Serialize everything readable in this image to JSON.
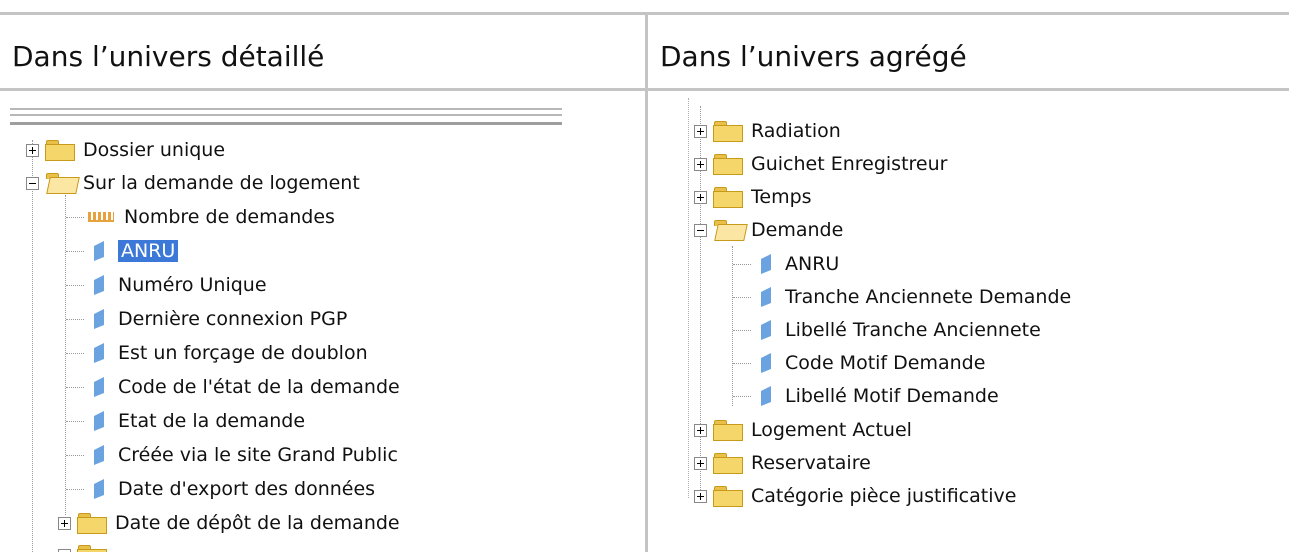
{
  "headers": {
    "left": "Dans l’univers détaillé",
    "right": "Dans l’univers agrégé"
  },
  "left_tree": {
    "folders": [
      {
        "label": "Dossier unique",
        "state": "collapsed"
      },
      {
        "label": "Sur la demande de logement",
        "state": "expanded"
      }
    ],
    "items": [
      {
        "label": "Nombre de demandes",
        "type": "measure"
      },
      {
        "label": "ANRU",
        "type": "dimension",
        "selected": true
      },
      {
        "label": "Numéro Unique",
        "type": "dimension"
      },
      {
        "label": "Dernière connexion PGP",
        "type": "dimension"
      },
      {
        "label": "Est un forçage de doublon",
        "type": "dimension"
      },
      {
        "label": "Code de l'état de la demande",
        "type": "dimension"
      },
      {
        "label": "Etat de la demande",
        "type": "dimension"
      },
      {
        "label": "Créée via le site Grand Public",
        "type": "dimension"
      },
      {
        "label": "Date d'export des données",
        "type": "dimension"
      }
    ],
    "subfolder": {
      "label": "Date de dépôt de la demande",
      "state": "collapsed"
    }
  },
  "right_tree": {
    "folders_top": [
      {
        "label": "Radiation"
      },
      {
        "label": "Guichet Enregistreur"
      },
      {
        "label": "Temps"
      }
    ],
    "open_folder": {
      "label": "Demande"
    },
    "items": [
      {
        "label": "ANRU"
      },
      {
        "label": "Tranche Anciennete Demande"
      },
      {
        "label": "Libellé Tranche Anciennete"
      },
      {
        "label": "Code Motif Demande"
      },
      {
        "label": "Libellé Motif Demande"
      }
    ],
    "folders_bottom": [
      {
        "label": "Logement Actuel"
      },
      {
        "label": "Reservataire"
      },
      {
        "label": "Catégorie pièce justificative"
      }
    ]
  }
}
